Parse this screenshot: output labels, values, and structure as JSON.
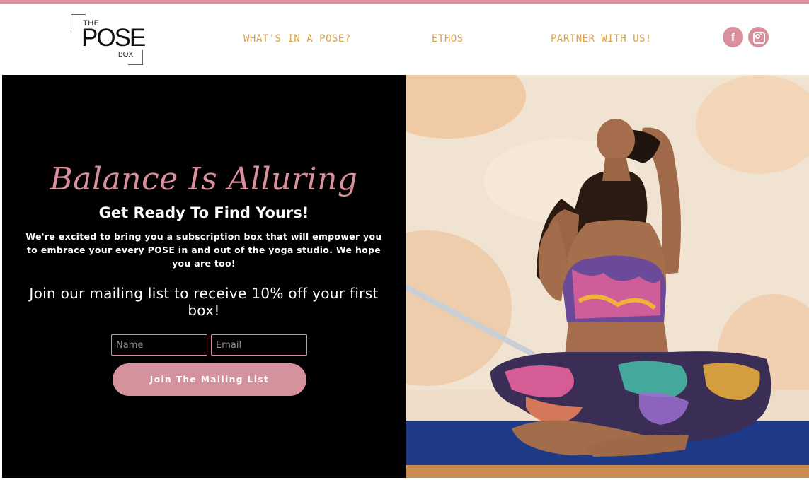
{
  "logo": {
    "line1": "THE",
    "line2": "POSE",
    "line3": "BOX"
  },
  "nav": {
    "items": [
      {
        "label": "WHAT'S IN A POSE?"
      },
      {
        "label": "ETHOS"
      },
      {
        "label": "PARTNER WITH US!"
      }
    ]
  },
  "social": {
    "facebook_glyph": "f",
    "facebook_icon": "facebook-icon",
    "instagram_icon": "instagram-icon"
  },
  "hero": {
    "tagline": "Balance Is Alluring",
    "subhead": "Get Ready To Find Yours!",
    "intro": "We're excited to bring you a subscription box that will empower you to embrace your every POSE in and out of the yoga studio. We hope you are too!",
    "join_text": "Join our mailing list to receive 10% off your first box!",
    "form": {
      "name_placeholder": "Name",
      "email_placeholder": "Email",
      "button_label": "Join The Mailing List"
    }
  },
  "colors": {
    "accent_pink": "#d98f9c",
    "nav_gold": "#d9a244",
    "hero_bg": "#000000"
  }
}
